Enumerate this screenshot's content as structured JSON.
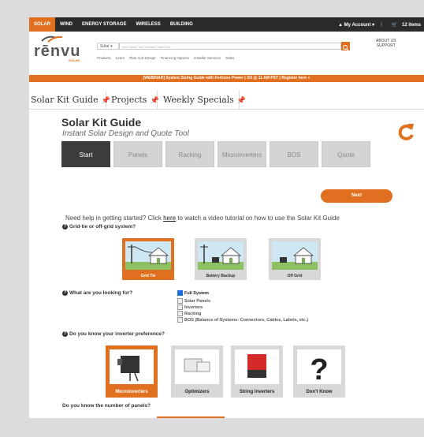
{
  "topnav": {
    "items": [
      "SOLAR",
      "WIND",
      "ENERGY STORAGE",
      "WIRELESS",
      "BUILDING"
    ],
    "account": "My Account",
    "cart": "12 items"
  },
  "header": {
    "logo_word": "rēnvu",
    "logo_sub": "SOLAR",
    "search_category": "Solar",
    "search_placeholder": "item name, part number, brand etc.",
    "about_line1": "ABOUT US",
    "about_line2": "SUPPORT",
    "subnav": [
      "Products",
      "Learn",
      "Plan And Design",
      "Financing Options",
      "Installer Services",
      "Sales"
    ]
  },
  "banner": "[WEBINAR] System Sizing Guide with Fortress Power | 3/3 @ 11 AM PST | Register here »",
  "tabs": [
    "Solar Kit Guide",
    "Projects",
    "Weekly Specials"
  ],
  "tool": {
    "title": "Solar Kit Guide",
    "subtitle": "Instant Solar Design and Quote Tool",
    "steps": [
      "Start",
      "Panels",
      "Racking",
      "Microinverters",
      "BOS",
      "Quote"
    ],
    "next_label": "Next",
    "help_prefix": "Need help in getting started? Click ",
    "help_link": "here",
    "help_suffix": " to watch a video tutorial on how to use the Solar Kit Guide"
  },
  "q1": {
    "label": "Grid-tie or off-grid system?",
    "options": [
      "Grid Tie",
      "Battery Backup",
      "Off Grid"
    ]
  },
  "q2": {
    "label": "What are you looking for?",
    "options": [
      "Full System",
      "Solar Panels",
      "Inverters",
      "Racking",
      "BOS (Balance of Systems: Connectors, Cables, Labels, etc.)"
    ]
  },
  "q3": {
    "label": "Do you know your inverter preference?",
    "options": [
      "Microinverters",
      "Optimizers",
      "String Inverters",
      "Don't Know"
    ]
  },
  "q4": {
    "label": "Do you know the number of panels?"
  },
  "colors": {
    "accent": "#e07020",
    "dark": "#2b2b2b"
  }
}
